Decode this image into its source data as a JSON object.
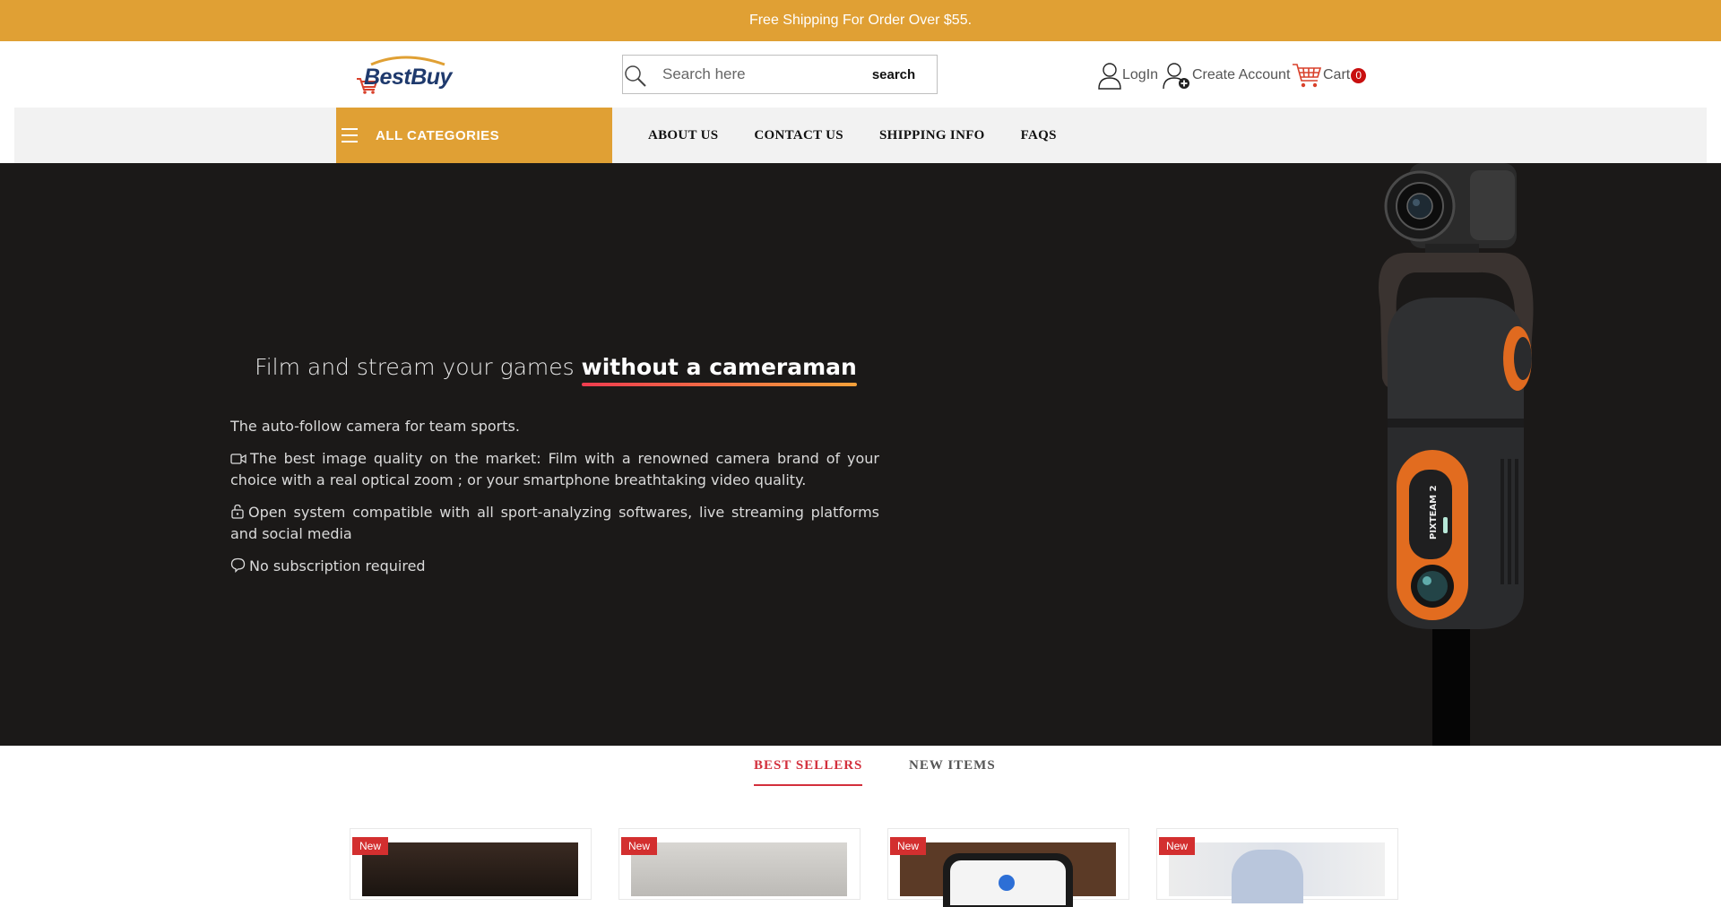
{
  "topbar": {
    "message": "Free Shipping For Order Over $55."
  },
  "header": {
    "logo": {
      "text_part1": "Best",
      "text_part2": "Buy"
    },
    "search": {
      "placeholder": "Search here",
      "button_label": "search"
    },
    "account": {
      "login_label": "LogIn",
      "create_label": "Create Account",
      "cart_label": "Cart",
      "cart_count": "0"
    }
  },
  "nav": {
    "all_categories": "ALL CATEGORIES",
    "links": [
      "ABOUT US",
      "CONTACT US",
      "SHIPPING INFO",
      "FAQS"
    ]
  },
  "hero": {
    "title_plain": "Film and stream your games ",
    "title_strong": "without a cameraman",
    "line1": "The auto-follow camera for team sports.",
    "line2": "The best image quality on the market: Film with a renowned camera brand of your choice with a real optical zoom ; or your smartphone breathtaking video quality.",
    "line3": "Open system compatible with all sport-analyzing softwares, live streaming platforms and social media",
    "line4": "No subscription required"
  },
  "tabs": {
    "active": "BEST SELLERS",
    "inactive": "NEW ITEMS"
  },
  "products": [
    {
      "badge": "New"
    },
    {
      "badge": "New"
    },
    {
      "badge": "New"
    },
    {
      "badge": "New"
    }
  ],
  "colors": {
    "accent": "#e0a034",
    "hero_bg": "#1b1918",
    "active_tab": "#d32f3c",
    "badge": "#d32f2f"
  }
}
